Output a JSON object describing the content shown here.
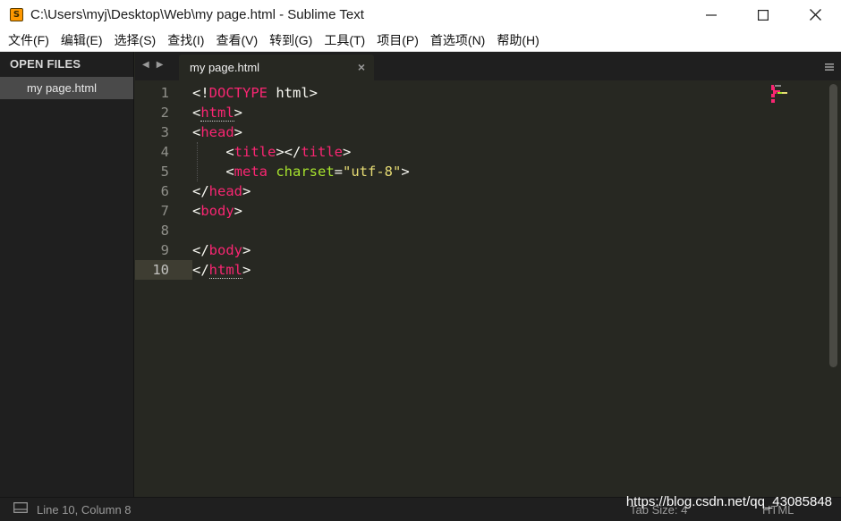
{
  "window": {
    "title": "C:\\Users\\myj\\Desktop\\Web\\my page.html - Sublime Text",
    "app_icon_glyph": "S"
  },
  "menu": [
    "文件(F)",
    "编辑(E)",
    "选择(S)",
    "查找(I)",
    "查看(V)",
    "转到(G)",
    "工具(T)",
    "项目(P)",
    "首选项(N)",
    "帮助(H)"
  ],
  "sidebar": {
    "header": "OPEN FILES",
    "files": [
      "my page.html"
    ]
  },
  "tabs": [
    {
      "label": "my page.html",
      "active": true
    }
  ],
  "editor": {
    "line_numbers": [
      "1",
      "2",
      "3",
      "4",
      "5",
      "6",
      "7",
      "8",
      "9",
      "10"
    ],
    "active_line": 10,
    "lines": [
      [
        {
          "t": "plain",
          "v": "<!"
        },
        {
          "t": "tag",
          "v": "DOCTYPE"
        },
        {
          "t": "plain",
          "v": " html>"
        }
      ],
      [
        {
          "t": "plain",
          "v": "<"
        },
        {
          "t": "tag",
          "v": "html"
        },
        {
          "t": "plain",
          "v": ">"
        }
      ],
      [
        {
          "t": "plain",
          "v": "<"
        },
        {
          "t": "tag",
          "v": "head"
        },
        {
          "t": "plain",
          "v": ">"
        }
      ],
      [
        {
          "t": "plain",
          "v": "    <"
        },
        {
          "t": "tag",
          "v": "title"
        },
        {
          "t": "plain",
          "v": "></"
        },
        {
          "t": "tag",
          "v": "title"
        },
        {
          "t": "plain",
          "v": ">"
        }
      ],
      [
        {
          "t": "plain",
          "v": "    <"
        },
        {
          "t": "tag",
          "v": "meta"
        },
        {
          "t": "plain",
          "v": " "
        },
        {
          "t": "attr",
          "v": "charset"
        },
        {
          "t": "plain",
          "v": "="
        },
        {
          "t": "str",
          "v": "\"utf-8\""
        },
        {
          "t": "plain",
          "v": ">"
        }
      ],
      [
        {
          "t": "plain",
          "v": "</"
        },
        {
          "t": "tag",
          "v": "head"
        },
        {
          "t": "plain",
          "v": ">"
        }
      ],
      [
        {
          "t": "plain",
          "v": "<"
        },
        {
          "t": "tag",
          "v": "body"
        },
        {
          "t": "plain",
          "v": ">"
        }
      ],
      [],
      [
        {
          "t": "plain",
          "v": "</"
        },
        {
          "t": "tag",
          "v": "body"
        },
        {
          "t": "plain",
          "v": ">"
        }
      ],
      [
        {
          "t": "plain",
          "v": "</"
        },
        {
          "t": "tag",
          "v": "html"
        },
        {
          "t": "plain",
          "v": ">"
        }
      ]
    ]
  },
  "status": {
    "position": "Line 10, Column 8",
    "tab_size": "Tab Size: 4",
    "syntax": "HTML"
  },
  "watermark": "https://blog.csdn.net/qq_43085848",
  "colors": {
    "tag": "#f92672",
    "attribute": "#a6e22e",
    "string": "#e6db74",
    "text": "#f8f8f2",
    "background": "#272822"
  }
}
